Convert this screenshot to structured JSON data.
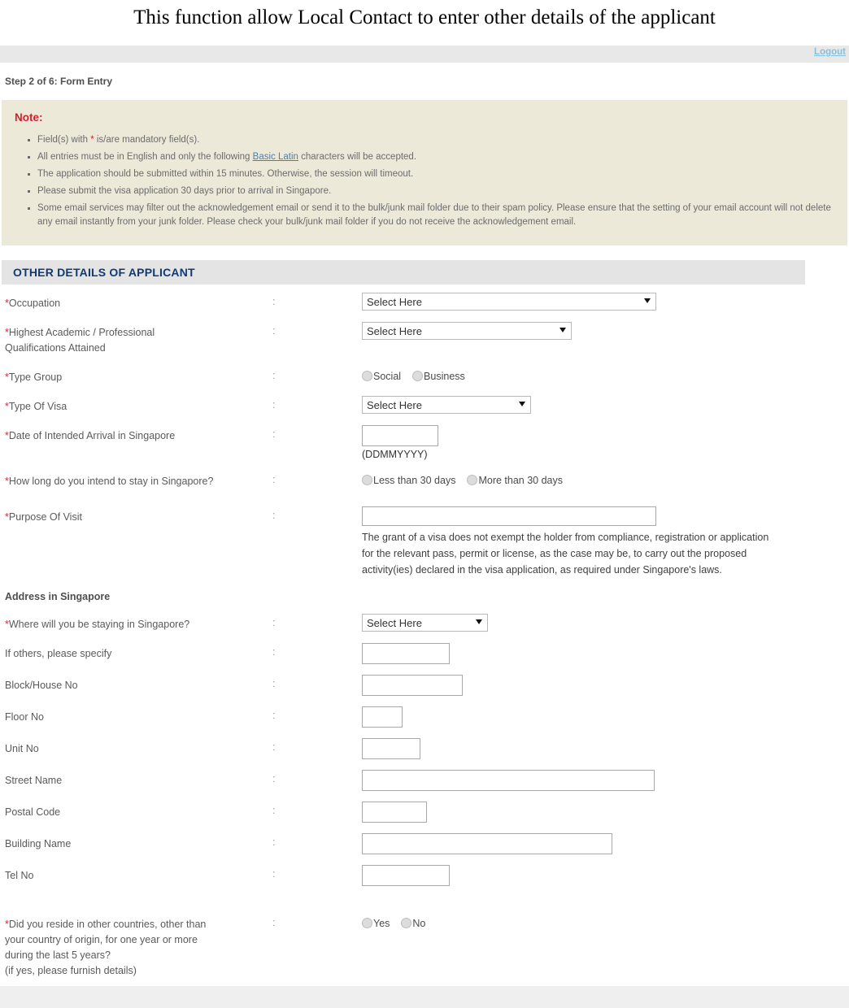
{
  "page": {
    "title": "This function allow Local Contact to enter other details of the applicant",
    "step_label": "Step 2 of 6: Form Entry"
  },
  "topbar": {
    "logout_label": "Logout"
  },
  "note": {
    "heading": "Note:",
    "items": [
      {
        "before": "Field(s) with ",
        "star": "*",
        "after": " is/are mandatory field(s)."
      },
      {
        "before": "All entries must be in English and only the following ",
        "link": "Basic Latin",
        "after": " characters will be accepted."
      },
      {
        "text": "The application should be submitted within 15 minutes. Otherwise, the session will timeout."
      },
      {
        "text": "Please submit the visa application 30 days prior to arrival in Singapore."
      },
      {
        "text": "Some email services may filter out the acknowledgement email or send it to the bulk/junk mail folder due to their spam policy. Please ensure that the setting of your email account will not delete any email instantly from your junk folder. Please check your bulk/junk mail folder if you do not receive the acknowledgement email."
      }
    ]
  },
  "section": {
    "title": "OTHER DETAILS OF APPLICANT"
  },
  "colon": ":",
  "select_placeholder": "Select Here",
  "fields": {
    "occupation": {
      "label": "Occupation",
      "required_mark": "*",
      "value": "Select Here"
    },
    "qualifications": {
      "label_line1": "Highest Academic / Professional",
      "label_line2": "Qualifications Attained",
      "required_mark": "*",
      "value": "Select Here"
    },
    "type_group": {
      "label": "Type Group",
      "required_mark": "*",
      "options": [
        "Social",
        "Business"
      ]
    },
    "type_of_visa": {
      "label": "Type Of Visa",
      "required_mark": "*",
      "value": "Select Here"
    },
    "arrival_date": {
      "label": "Date of Intended Arrival in Singapore",
      "required_mark": "*",
      "value": "",
      "format_hint": "(DDMMYYYY)"
    },
    "stay_duration": {
      "label": "How long do you intend to stay in Singapore?",
      "required_mark": "*",
      "options": [
        "Less than 30 days",
        "More than 30 days"
      ]
    },
    "purpose_of_visit": {
      "label": "Purpose Of Visit",
      "required_mark": "*",
      "value": "",
      "helper": "The grant of a visa does not exempt the holder from compliance, registration or application for the relevant pass, permit or license, as the case may be, to carry out the proposed activity(ies) declared in the visa application, as required under Singapore's laws."
    }
  },
  "address_section": {
    "title": "Address in Singapore",
    "staying_where": {
      "label": "Where will you be staying in Singapore?",
      "required_mark": "*",
      "value": "Select Here"
    },
    "if_others": {
      "label": "If others, please specify",
      "value": ""
    },
    "block_house_no": {
      "label": "Block/House No",
      "value": ""
    },
    "floor_no": {
      "label": "Floor No",
      "value": ""
    },
    "unit_no": {
      "label": "Unit No",
      "value": ""
    },
    "street_name": {
      "label": "Street Name",
      "value": ""
    },
    "postal_code": {
      "label": "Postal Code",
      "value": ""
    },
    "building_name": {
      "label": "Building Name",
      "value": ""
    },
    "tel_no": {
      "label": "Tel No",
      "value": ""
    }
  },
  "residency": {
    "required_mark": "*",
    "label_line1": "Did you reside in other countries, other than",
    "label_line2": "your country of origin, for one year or more",
    "label_line3": "during the last 5 years?",
    "label_line4": "(if yes, please furnish details)",
    "options": [
      "Yes",
      "No"
    ]
  },
  "colors": {
    "note_bg": "#ede9d9",
    "section_bar_bg": "#e4e4e4",
    "section_title": "#123a72",
    "required_red": "#e0262e",
    "note_heading_red": "#d0202c",
    "link_blue": "#4a7faa",
    "logout_blue": "#86c0dd"
  }
}
